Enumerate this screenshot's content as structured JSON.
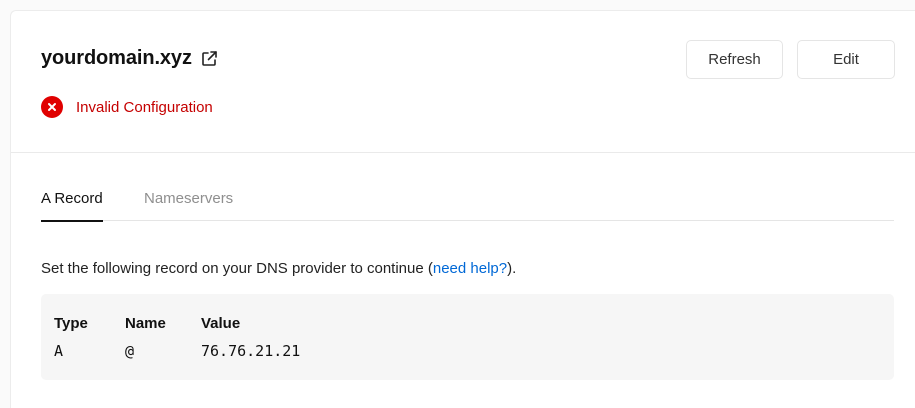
{
  "domain": {
    "name": "yourdomain.xyz",
    "link_icon": "external-link-icon",
    "status_icon": "error-x-icon",
    "status_text": "Invalid Configuration",
    "status_color": "#e00000"
  },
  "actions": {
    "refresh_label": "Refresh",
    "edit_label": "Edit"
  },
  "tabs": [
    {
      "label": "A Record",
      "active": true
    },
    {
      "label": "Nameservers",
      "active": false
    }
  ],
  "instructions": {
    "before": "Set the following record on your DNS provider to continue (",
    "link_text": "need help?",
    "after": ")."
  },
  "record_table": {
    "headers": [
      "Type",
      "Name",
      "Value"
    ],
    "rows": [
      [
        "A",
        "@",
        "76.76.21.21"
      ]
    ]
  },
  "colors": {
    "link": "#0068d6",
    "error_text": "#c50000"
  }
}
